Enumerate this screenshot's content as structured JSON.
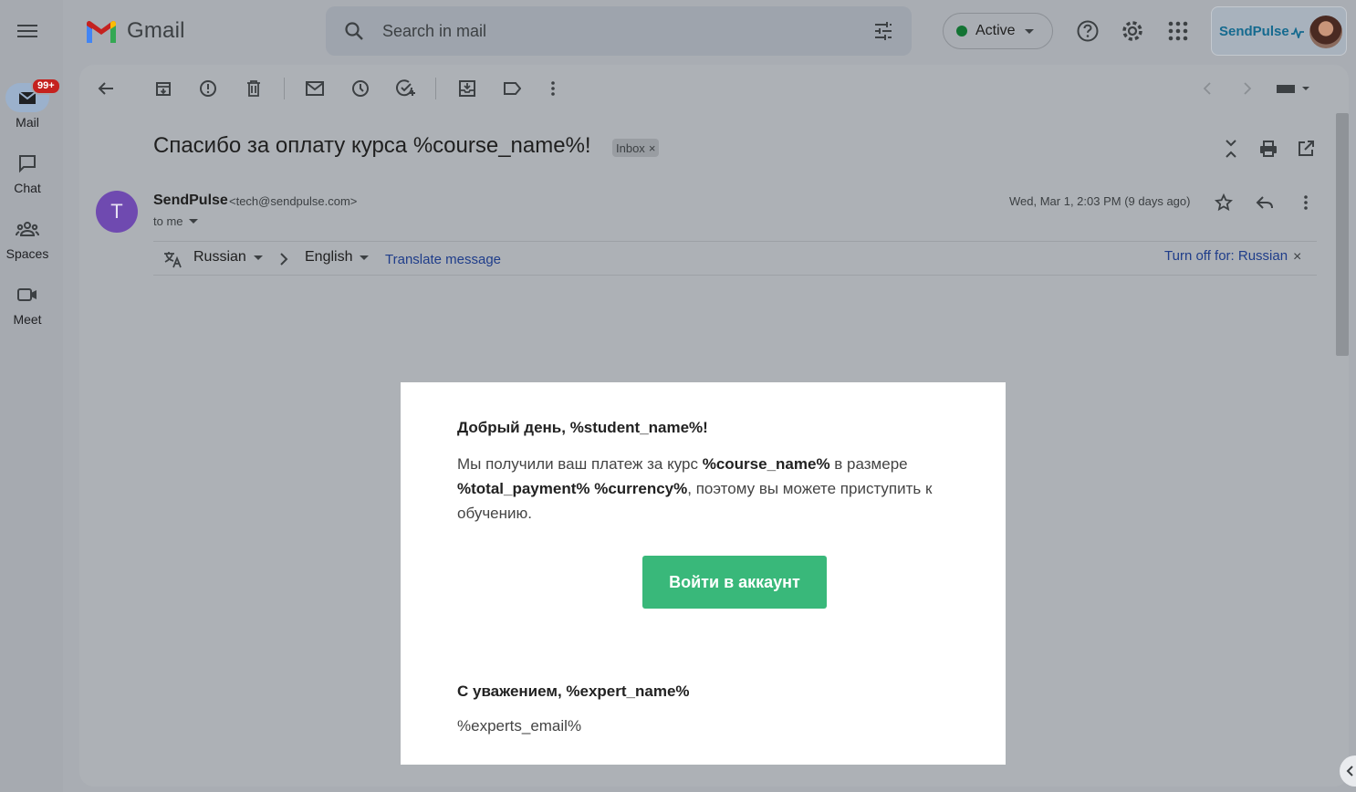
{
  "app": {
    "name": "Gmail"
  },
  "rail": {
    "items": [
      {
        "label": "Mail",
        "badge": "99+"
      },
      {
        "label": "Chat"
      },
      {
        "label": "Spaces"
      },
      {
        "label": "Meet"
      }
    ]
  },
  "search": {
    "placeholder": "Search in mail"
  },
  "status": {
    "label": "Active",
    "color": "#137333"
  },
  "account": {
    "brand": "SendPulse"
  },
  "email": {
    "subject": "Спасибо за оплату курса %course_name%!",
    "label": "Inbox",
    "sender_initial": "T",
    "sender_name": "SendPulse",
    "sender_email": "<tech@sendpulse.com>",
    "to": "to me",
    "date": "Wed, Mar 1, 2:03 PM (9 days ago)"
  },
  "translate": {
    "from": "Russian",
    "to": "English",
    "action": "Translate message",
    "turn_off": "Turn off for: Russian"
  },
  "body": {
    "greeting": "Добрый день, %student_name%!",
    "p1": "Мы получили ваш платеж за курс ",
    "course": "%course_name%",
    "p2": " в размере ",
    "payment": "%total_payment% %currency%",
    "p3": ", поэтому вы можете приступить к обучению.",
    "button": "Войти в аккаунт",
    "regards": "С уважением, %expert_name%",
    "expert_email": "%experts_email%",
    "button_color": "#39b87a"
  }
}
